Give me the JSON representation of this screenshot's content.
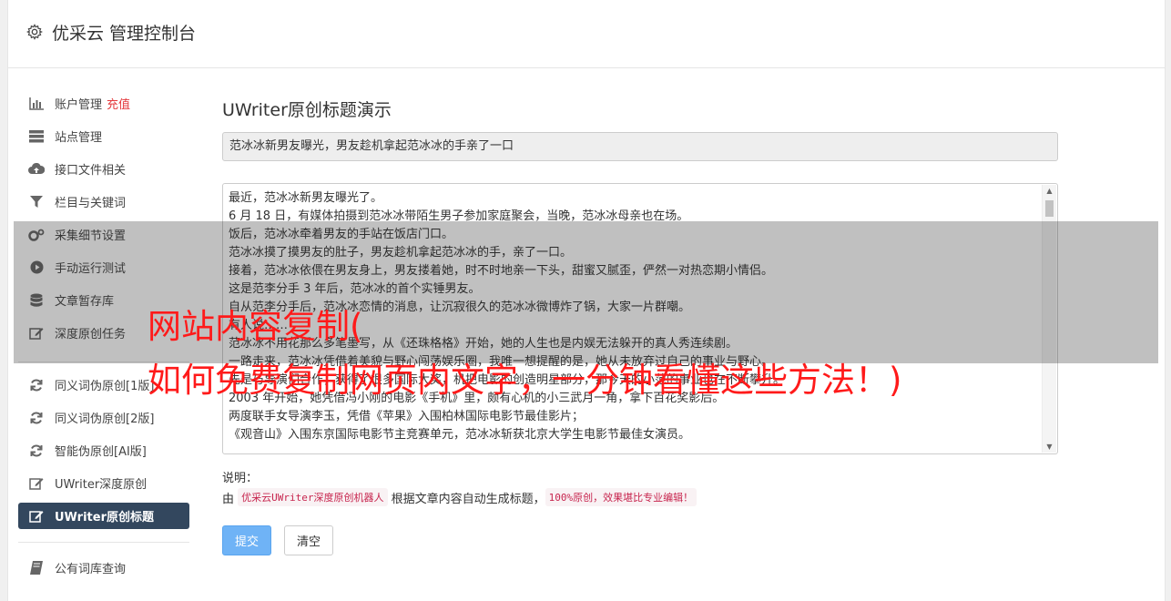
{
  "header": {
    "title": "优采云 管理控制台",
    "icon": "gear-icon"
  },
  "sidebar": {
    "items": [
      {
        "label": "账户管理",
        "extra": "充值",
        "icon": "bar-chart-icon"
      },
      {
        "label": "站点管理",
        "icon": "server-icon"
      },
      {
        "label": "接口文件相关",
        "icon": "cloud-upload-icon"
      },
      {
        "label": "栏目与关键词",
        "icon": "filter-icon"
      },
      {
        "label": "采集细节设置",
        "icon": "gears-icon"
      },
      {
        "label": "手动运行测试",
        "icon": "play-circle-icon"
      },
      {
        "label": "文章暂存库",
        "icon": "database-icon"
      },
      {
        "label": "深度原创任务",
        "icon": "edit-icon"
      },
      {
        "label": "同义词伪原创[1版]",
        "icon": "refresh-icon"
      },
      {
        "label": "同义词伪原创[2版]",
        "icon": "refresh-icon"
      },
      {
        "label": "智能伪原创[AI版]",
        "icon": "refresh-icon"
      },
      {
        "label": "UWriter深度原创",
        "icon": "edit-icon"
      },
      {
        "label": "UWriter原创标题",
        "icon": "edit-icon",
        "active": true
      },
      {
        "label": "公有词库查询",
        "icon": "book-icon"
      }
    ]
  },
  "main": {
    "title": "UWriter原创标题演示",
    "title_value": "范冰冰新男友曝光，男友趁机拿起范冰冰的手亲了一口",
    "content_lines": [
      "最近，范冰冰新男友曝光了。",
      "6 月 18 日，有媒体拍摄到范冰冰带陌生男子参加家庭聚会，当晚，范冰冰母亲也在场。",
      "饭后，范冰冰牵着男友的手站在饭店门口。",
      "范冰冰摸了摸男友的肚子，男友趁机拿起范冰冰的手，亲了一口。",
      "接着，范冰冰依偎在男友身上，男友搂着她，时不时地亲一下头，甜蜜又腻歪，俨然一对热恋期小情侣。",
      "这是范李分手 3 年后，范冰冰的首个实锤男友。",
      "自从范李分手后，范冰冰恋情的消息，让沉寂很久的范冰冰微博炸了锅，大家一片群嘲。",
      "有人说……",
      "范冰冰不用花那么多笔墨写，从《还珠格格》开始，她的人生也是内娱无法躲开的真人秀连续剧。",
      "一路走来，范冰冰凭借着美貌与野心闯荡娱乐圈，我唯一想提醒的是，她从未放弃过自己的事业与野心。",
      "先是与导演们合作，获得了很多国际大奖，机把电影的创造明星部分，那今天的小范的事业也在不断攀升。",
      "2003 年开始，她凭借冯小刚的电影《手机》里，颇有心机的小三武月一角，拿下百花奖影后。",
      "两度联手女导演李玉，凭借《苹果》入围柏林国际电影节最佳影片；",
      "《观音山》入围东京国际电影节主竞赛单元，范冰冰斩获北京大学生电影节最佳女演员。"
    ],
    "note_label": "说明：",
    "note_prefix": "由",
    "note_code1": "优采云UWriter深度原创机器人",
    "note_middle": "根据文章内容自动生成标题，",
    "note_code2": "100%原创，效果堪比专业编辑！",
    "submit_label": "提交",
    "clear_label": "清空"
  },
  "watermark": {
    "line1": "网站内容复制(",
    "line2": "如何免费复制网页内文字，一分钟看懂这些方法！)"
  }
}
